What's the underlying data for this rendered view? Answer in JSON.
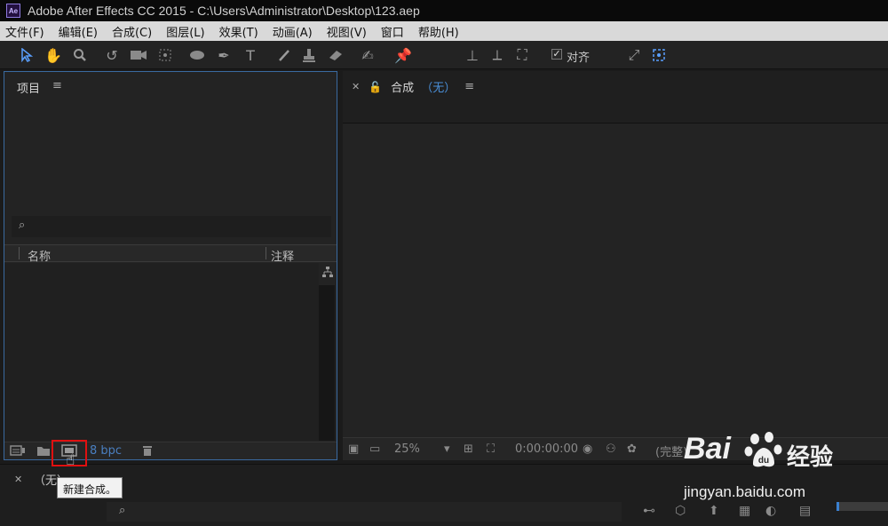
{
  "titlebar": {
    "icon_text": "Ae",
    "title": "Adobe After Effects CC 2015 - C:\\Users\\Administrator\\Desktop\\123.aep"
  },
  "menu": {
    "items": [
      "文件(F)",
      "编辑(E)",
      "合成(C)",
      "图层(L)",
      "效果(T)",
      "动画(A)",
      "视图(V)",
      "窗口",
      "帮助(H)"
    ]
  },
  "toolbar": {
    "tools": [
      "selection-icon",
      "hand-icon",
      "zoom-icon",
      "rotate-icon",
      "camera-icon",
      "pan-behind-icon",
      "ellipse-icon",
      "pen-icon",
      "type-icon",
      "brush-icon",
      "clone-stamp-icon",
      "eraser-icon",
      "roto-brush-icon",
      "puppet-pin-icon",
      "axis-local-icon",
      "axis-world-icon",
      "axis-view-icon",
      "snap-icon",
      "snap-target-icon"
    ],
    "align_checked": "✓",
    "align_label": "对齐"
  },
  "project_panel": {
    "title": "项目",
    "menu_glyph": "≡",
    "search_glyph": "⌕",
    "columns": {
      "name": "名称",
      "comment": "注释"
    },
    "bpc_label": "8 bpc",
    "new_comp_tooltip": "新建合成。"
  },
  "composition_panel": {
    "title": "合成",
    "none_label": "（无）",
    "zoom": "25%",
    "timecode": "0:00:00:00",
    "resolution": "(完整)"
  },
  "timeline_panel": {
    "title": "（无）"
  },
  "watermark": {
    "bai": "Bai",
    "jingyan": "经验",
    "url": "jingyan.baidu.com"
  },
  "colors": {
    "accent": "#3a80d0",
    "highlight": "#e01010",
    "none_label": "#4a8fd8"
  }
}
